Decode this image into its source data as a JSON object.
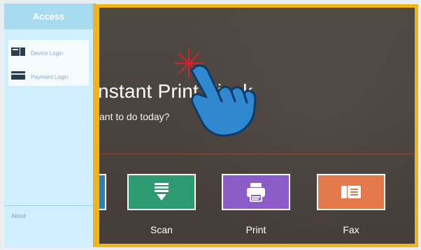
{
  "access_panel": {
    "title": "Access",
    "items": [
      {
        "label": "Device Login"
      },
      {
        "label": "Payment Login"
      }
    ],
    "footer": {
      "about_label": "About",
      "footer_text": ""
    }
  },
  "kiosk": {
    "title_partial": "nstant Print Kiosk",
    "subtitle_partial": "ant to do today?",
    "tiles": [
      {
        "name": "Scan",
        "color": "#2d9b71",
        "icon": "scan-icon"
      },
      {
        "name": "Print",
        "color": "#8c5cc8",
        "icon": "print-icon"
      },
      {
        "name": "Fax",
        "color": "#e3784b",
        "icon": "fax-icon"
      }
    ],
    "partial_tile": {
      "color": "#2f7fb3"
    },
    "accent": "#f1b21a"
  },
  "overlay": {
    "cursor_icon": "pointing-hand-cursor-icon"
  }
}
